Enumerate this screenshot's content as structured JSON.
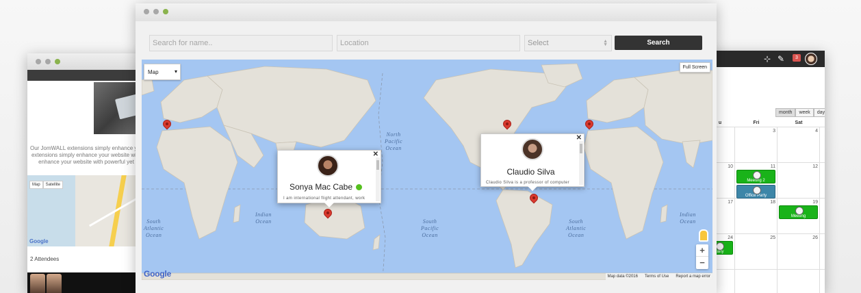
{
  "left_window": {
    "promo_lines": [
      "Our JomWALL extensions simply enhance your website",
      "extensions simply enhance your website with powerful",
      "enhance your website with powerful yet versatile"
    ],
    "map_tabs": [
      "Map",
      "Satellite"
    ],
    "google_label": "Google",
    "attendees_label": "2 Attendees"
  },
  "search": {
    "name_placeholder": "Search for name..",
    "location_placeholder": "Location",
    "select_value": "Select",
    "button_label": "Search"
  },
  "map": {
    "type_label": "Map",
    "fullscreen_label": "Full Screen",
    "google_label": "Google",
    "attribution": [
      "Map data ©2016",
      "Terms of Use",
      "Report a map error"
    ],
    "zoom_in": "+",
    "zoom_out": "−",
    "oceans": {
      "north_pacific": [
        "North",
        "Pacific",
        "Ocean"
      ],
      "south_pacific": [
        "South",
        "Pacific",
        "Ocean"
      ],
      "indian": [
        "Indian",
        "Ocean"
      ],
      "south_atlantic_left": [
        "South",
        "Atlantic",
        "Ocean"
      ],
      "south_atlantic_right": [
        "South",
        "Atlantic",
        "Ocean"
      ],
      "indian_right": [
        "Indian",
        "Ocean"
      ]
    },
    "popups": [
      {
        "name": "Sonya Mac Cabe",
        "online": true,
        "description": "I am international flight attendant, work"
      },
      {
        "name": "Claudio Silva",
        "online": false,
        "description": "Claudio Silva is a professor of computer"
      }
    ]
  },
  "right_window": {
    "notification_count": "3",
    "view_buttons": [
      "month",
      "week",
      "day"
    ],
    "day_headers": [
      "u",
      "Fri",
      "Sat"
    ],
    "rows": [
      [
        "",
        "3",
        "4"
      ],
      [
        "10",
        "11",
        "12"
      ],
      [
        "17",
        "18",
        "19"
      ],
      [
        "24",
        "25",
        "26"
      ]
    ],
    "events": [
      {
        "label": "Meeting 2",
        "color": "#19b319"
      },
      {
        "label": "Office Party",
        "color": "#3d86a8"
      },
      {
        "label": "Meeting",
        "color": "#19b319"
      },
      {
        "label": "Party",
        "color": "#19b319"
      }
    ]
  }
}
